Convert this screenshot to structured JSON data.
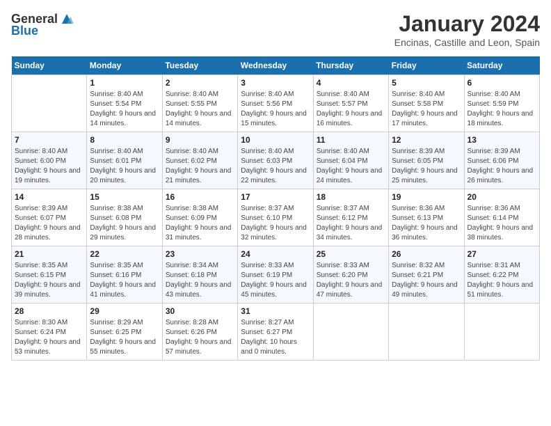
{
  "logo": {
    "general": "General",
    "blue": "Blue"
  },
  "title": "January 2024",
  "subtitle": "Encinas, Castille and Leon, Spain",
  "days_header": [
    "Sunday",
    "Monday",
    "Tuesday",
    "Wednesday",
    "Thursday",
    "Friday",
    "Saturday"
  ],
  "weeks": [
    [
      {
        "day": "",
        "sunrise": "",
        "sunset": "",
        "daylight": ""
      },
      {
        "day": "1",
        "sunrise": "Sunrise: 8:40 AM",
        "sunset": "Sunset: 5:54 PM",
        "daylight": "Daylight: 9 hours and 14 minutes."
      },
      {
        "day": "2",
        "sunrise": "Sunrise: 8:40 AM",
        "sunset": "Sunset: 5:55 PM",
        "daylight": "Daylight: 9 hours and 14 minutes."
      },
      {
        "day": "3",
        "sunrise": "Sunrise: 8:40 AM",
        "sunset": "Sunset: 5:56 PM",
        "daylight": "Daylight: 9 hours and 15 minutes."
      },
      {
        "day": "4",
        "sunrise": "Sunrise: 8:40 AM",
        "sunset": "Sunset: 5:57 PM",
        "daylight": "Daylight: 9 hours and 16 minutes."
      },
      {
        "day": "5",
        "sunrise": "Sunrise: 8:40 AM",
        "sunset": "Sunset: 5:58 PM",
        "daylight": "Daylight: 9 hours and 17 minutes."
      },
      {
        "day": "6",
        "sunrise": "Sunrise: 8:40 AM",
        "sunset": "Sunset: 5:59 PM",
        "daylight": "Daylight: 9 hours and 18 minutes."
      }
    ],
    [
      {
        "day": "7",
        "sunrise": "Sunrise: 8:40 AM",
        "sunset": "Sunset: 6:00 PM",
        "daylight": "Daylight: 9 hours and 19 minutes."
      },
      {
        "day": "8",
        "sunrise": "Sunrise: 8:40 AM",
        "sunset": "Sunset: 6:01 PM",
        "daylight": "Daylight: 9 hours and 20 minutes."
      },
      {
        "day": "9",
        "sunrise": "Sunrise: 8:40 AM",
        "sunset": "Sunset: 6:02 PM",
        "daylight": "Daylight: 9 hours and 21 minutes."
      },
      {
        "day": "10",
        "sunrise": "Sunrise: 8:40 AM",
        "sunset": "Sunset: 6:03 PM",
        "daylight": "Daylight: 9 hours and 22 minutes."
      },
      {
        "day": "11",
        "sunrise": "Sunrise: 8:40 AM",
        "sunset": "Sunset: 6:04 PM",
        "daylight": "Daylight: 9 hours and 24 minutes."
      },
      {
        "day": "12",
        "sunrise": "Sunrise: 8:39 AM",
        "sunset": "Sunset: 6:05 PM",
        "daylight": "Daylight: 9 hours and 25 minutes."
      },
      {
        "day": "13",
        "sunrise": "Sunrise: 8:39 AM",
        "sunset": "Sunset: 6:06 PM",
        "daylight": "Daylight: 9 hours and 26 minutes."
      }
    ],
    [
      {
        "day": "14",
        "sunrise": "Sunrise: 8:39 AM",
        "sunset": "Sunset: 6:07 PM",
        "daylight": "Daylight: 9 hours and 28 minutes."
      },
      {
        "day": "15",
        "sunrise": "Sunrise: 8:38 AM",
        "sunset": "Sunset: 6:08 PM",
        "daylight": "Daylight: 9 hours and 29 minutes."
      },
      {
        "day": "16",
        "sunrise": "Sunrise: 8:38 AM",
        "sunset": "Sunset: 6:09 PM",
        "daylight": "Daylight: 9 hours and 31 minutes."
      },
      {
        "day": "17",
        "sunrise": "Sunrise: 8:37 AM",
        "sunset": "Sunset: 6:10 PM",
        "daylight": "Daylight: 9 hours and 32 minutes."
      },
      {
        "day": "18",
        "sunrise": "Sunrise: 8:37 AM",
        "sunset": "Sunset: 6:12 PM",
        "daylight": "Daylight: 9 hours and 34 minutes."
      },
      {
        "day": "19",
        "sunrise": "Sunrise: 8:36 AM",
        "sunset": "Sunset: 6:13 PM",
        "daylight": "Daylight: 9 hours and 36 minutes."
      },
      {
        "day": "20",
        "sunrise": "Sunrise: 8:36 AM",
        "sunset": "Sunset: 6:14 PM",
        "daylight": "Daylight: 9 hours and 38 minutes."
      }
    ],
    [
      {
        "day": "21",
        "sunrise": "Sunrise: 8:35 AM",
        "sunset": "Sunset: 6:15 PM",
        "daylight": "Daylight: 9 hours and 39 minutes."
      },
      {
        "day": "22",
        "sunrise": "Sunrise: 8:35 AM",
        "sunset": "Sunset: 6:16 PM",
        "daylight": "Daylight: 9 hours and 41 minutes."
      },
      {
        "day": "23",
        "sunrise": "Sunrise: 8:34 AM",
        "sunset": "Sunset: 6:18 PM",
        "daylight": "Daylight: 9 hours and 43 minutes."
      },
      {
        "day": "24",
        "sunrise": "Sunrise: 8:33 AM",
        "sunset": "Sunset: 6:19 PM",
        "daylight": "Daylight: 9 hours and 45 minutes."
      },
      {
        "day": "25",
        "sunrise": "Sunrise: 8:33 AM",
        "sunset": "Sunset: 6:20 PM",
        "daylight": "Daylight: 9 hours and 47 minutes."
      },
      {
        "day": "26",
        "sunrise": "Sunrise: 8:32 AM",
        "sunset": "Sunset: 6:21 PM",
        "daylight": "Daylight: 9 hours and 49 minutes."
      },
      {
        "day": "27",
        "sunrise": "Sunrise: 8:31 AM",
        "sunset": "Sunset: 6:22 PM",
        "daylight": "Daylight: 9 hours and 51 minutes."
      }
    ],
    [
      {
        "day": "28",
        "sunrise": "Sunrise: 8:30 AM",
        "sunset": "Sunset: 6:24 PM",
        "daylight": "Daylight: 9 hours and 53 minutes."
      },
      {
        "day": "29",
        "sunrise": "Sunrise: 8:29 AM",
        "sunset": "Sunset: 6:25 PM",
        "daylight": "Daylight: 9 hours and 55 minutes."
      },
      {
        "day": "30",
        "sunrise": "Sunrise: 8:28 AM",
        "sunset": "Sunset: 6:26 PM",
        "daylight": "Daylight: 9 hours and 57 minutes."
      },
      {
        "day": "31",
        "sunrise": "Sunrise: 8:27 AM",
        "sunset": "Sunset: 6:27 PM",
        "daylight": "Daylight: 10 hours and 0 minutes."
      },
      {
        "day": "",
        "sunrise": "",
        "sunset": "",
        "daylight": ""
      },
      {
        "day": "",
        "sunrise": "",
        "sunset": "",
        "daylight": ""
      },
      {
        "day": "",
        "sunrise": "",
        "sunset": "",
        "daylight": ""
      }
    ]
  ]
}
